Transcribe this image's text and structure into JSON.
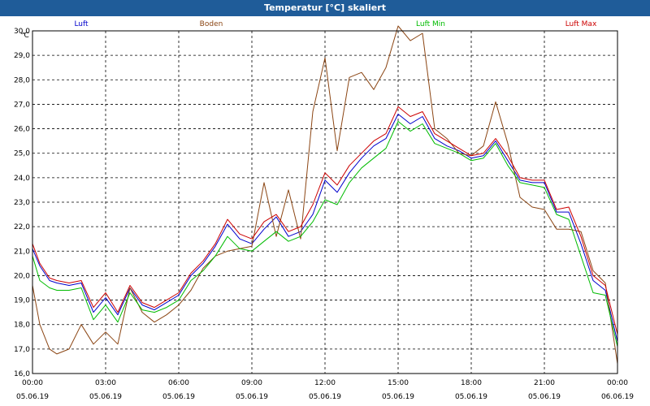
{
  "window": {
    "title": "Temperatur [°C] skaliert"
  },
  "chart_data": {
    "type": "line",
    "title": "Temperatur [°C] skaliert",
    "ylabel": "°C",
    "ylim": [
      16.0,
      30.0
    ],
    "y_ticks": [
      "16,0",
      "17,0",
      "18,0",
      "19,0",
      "20,0",
      "21,0",
      "22,0",
      "23,0",
      "24,0",
      "25,0",
      "26,0",
      "27,0",
      "28,0",
      "29,0",
      "30,0"
    ],
    "x_range_hours": [
      0,
      24
    ],
    "x_ticks": [
      {
        "hour": 0,
        "time": "00:00",
        "date": "05.06.19"
      },
      {
        "hour": 3,
        "time": "03:00",
        "date": "05.06.19"
      },
      {
        "hour": 6,
        "time": "06:00",
        "date": "05.06.19"
      },
      {
        "hour": 9,
        "time": "09:00",
        "date": "05.06.19"
      },
      {
        "hour": 12,
        "time": "12:00",
        "date": "05.06.19"
      },
      {
        "hour": 15,
        "time": "15:00",
        "date": "05.06.19"
      },
      {
        "hour": 18,
        "time": "18:00",
        "date": "05.06.19"
      },
      {
        "hour": 21,
        "time": "21:00",
        "date": "05.06.19"
      },
      {
        "hour": 24,
        "time": "00:00",
        "date": "06.06.19"
      }
    ],
    "grid": true,
    "legend_position": "top",
    "x": [
      0,
      0.3,
      0.7,
      1,
      1.5,
      2,
      2.5,
      3,
      3.5,
      4,
      4.5,
      5,
      5.5,
      6,
      6.5,
      7,
      7.5,
      8,
      8.5,
      9,
      9.5,
      10,
      10.5,
      11,
      11.5,
      12,
      12.5,
      13,
      13.5,
      14,
      14.5,
      15,
      15.5,
      16,
      16.5,
      17,
      17.5,
      18,
      18.5,
      19,
      19.5,
      20,
      20.5,
      21,
      21.5,
      22,
      22.5,
      23,
      23.5,
      24
    ],
    "series": [
      {
        "name": "Luft",
        "color": "#0000cc",
        "values": [
          21.1,
          20.4,
          19.8,
          19.7,
          19.6,
          19.7,
          18.5,
          19.1,
          18.4,
          19.5,
          18.8,
          18.6,
          18.9,
          19.2,
          20.0,
          20.5,
          21.2,
          22.1,
          21.5,
          21.3,
          21.9,
          22.4,
          21.6,
          21.8,
          22.5,
          23.9,
          23.4,
          24.2,
          24.8,
          25.3,
          25.6,
          26.6,
          26.2,
          26.5,
          25.6,
          25.3,
          25.1,
          24.8,
          24.9,
          25.5,
          24.7,
          23.9,
          23.8,
          23.8,
          22.6,
          22.6,
          21.3,
          19.8,
          19.4,
          17.3
        ]
      },
      {
        "name": "Boden",
        "color": "#8b4513",
        "values": [
          19.6,
          18.0,
          17.0,
          16.8,
          17.0,
          18.0,
          17.2,
          17.7,
          17.2,
          19.5,
          18.5,
          18.1,
          18.4,
          18.8,
          19.4,
          20.3,
          20.8,
          21.0,
          21.1,
          21.2,
          23.8,
          21.6,
          23.5,
          21.5,
          26.7,
          28.9,
          25.1,
          28.1,
          28.3,
          27.6,
          28.5,
          30.2,
          29.6,
          29.9,
          26.0,
          25.6,
          25.0,
          24.9,
          25.3,
          27.1,
          25.4,
          23.2,
          22.8,
          22.7,
          21.9,
          21.9,
          21.8,
          20.2,
          19.7,
          16.4
        ]
      },
      {
        "name": "Luft Min",
        "color": "#00bb00",
        "values": [
          20.8,
          19.8,
          19.5,
          19.4,
          19.4,
          19.5,
          18.2,
          18.8,
          18.1,
          19.3,
          18.6,
          18.5,
          18.7,
          19.0,
          19.8,
          20.2,
          20.8,
          21.6,
          21.1,
          21.0,
          21.4,
          21.8,
          21.4,
          21.6,
          22.2,
          23.1,
          22.9,
          23.8,
          24.4,
          24.8,
          25.2,
          26.3,
          25.9,
          26.2,
          25.4,
          25.2,
          25.0,
          24.7,
          24.8,
          25.4,
          24.5,
          23.8,
          23.7,
          23.6,
          22.5,
          22.3,
          20.8,
          19.3,
          19.2,
          17.1
        ]
      },
      {
        "name": "Luft Max",
        "color": "#cc0000",
        "values": [
          21.3,
          20.5,
          19.9,
          19.8,
          19.7,
          19.8,
          18.7,
          19.3,
          18.5,
          19.6,
          18.9,
          18.7,
          19.0,
          19.3,
          20.1,
          20.6,
          21.3,
          22.3,
          21.7,
          21.5,
          22.2,
          22.5,
          21.8,
          22.0,
          22.9,
          24.2,
          23.7,
          24.5,
          25.0,
          25.5,
          25.8,
          26.9,
          26.5,
          26.7,
          25.8,
          25.5,
          25.2,
          24.9,
          25.0,
          25.6,
          24.9,
          24.0,
          23.9,
          23.9,
          22.7,
          22.8,
          21.6,
          20.0,
          19.6,
          17.6
        ]
      }
    ]
  }
}
